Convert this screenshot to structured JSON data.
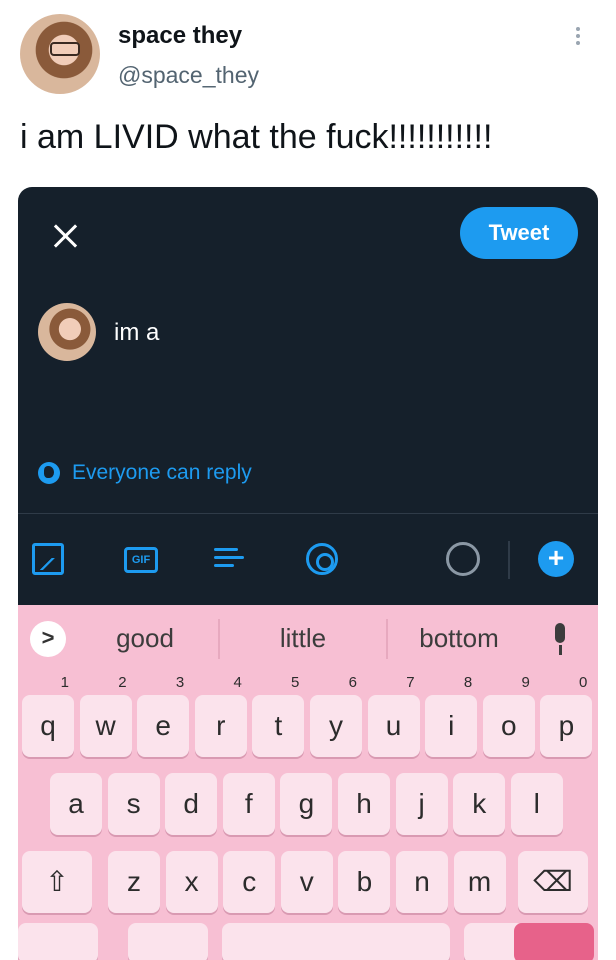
{
  "tweet": {
    "display_name": "space they",
    "handle": "@space_they",
    "text": "i am LIVID what the fuck!!!!!!!!!!!"
  },
  "compose": {
    "tweet_button": "Tweet",
    "text": "im a",
    "reply_setting": "Everyone can reply",
    "toolbar_icons": [
      "image-icon",
      "gif-icon",
      "poll-icon",
      "location-icon",
      "progress-icon",
      "add-icon"
    ],
    "gif_label": "GIF",
    "add_label": "+"
  },
  "keyboard": {
    "expand_label": ">",
    "suggestions": [
      "good",
      "little",
      "bottom"
    ],
    "row1": [
      "q",
      "w",
      "e",
      "r",
      "t",
      "y",
      "u",
      "i",
      "o",
      "p"
    ],
    "row1_hints": [
      "1",
      "2",
      "3",
      "4",
      "5",
      "6",
      "7",
      "8",
      "9",
      "0"
    ],
    "row2": [
      "a",
      "s",
      "d",
      "f",
      "g",
      "h",
      "j",
      "k",
      "l"
    ],
    "row3": [
      "z",
      "x",
      "c",
      "v",
      "b",
      "n",
      "m"
    ],
    "shift_label": "⇧",
    "backspace_label": "⌫"
  },
  "colors": {
    "accent": "#1d9bf0",
    "compose_bg": "#15202b",
    "keyboard_bg": "#f7bfd3"
  }
}
